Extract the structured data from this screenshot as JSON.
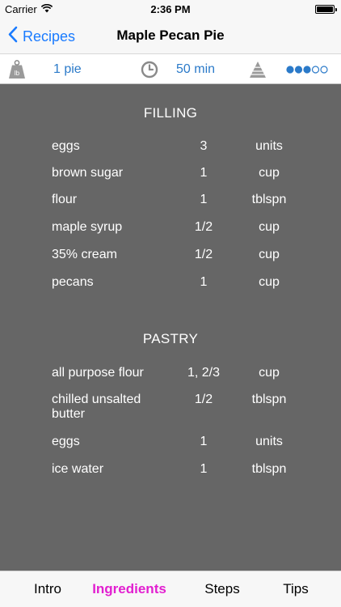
{
  "status": {
    "carrier": "Carrier",
    "time": "2:36 PM"
  },
  "nav": {
    "back_label": "Recipes",
    "title": "Maple Pecan Pie"
  },
  "info": {
    "yield": "1 pie",
    "time": "50 min",
    "difficulty_level": 3,
    "difficulty_max": 5
  },
  "sections": [
    {
      "title": "FILLING",
      "items": [
        {
          "name": "eggs",
          "qty": "3",
          "unit": "units"
        },
        {
          "name": "brown sugar",
          "qty": "1",
          "unit": "cup"
        },
        {
          "name": "flour",
          "qty": "1",
          "unit": "tblspn"
        },
        {
          "name": "maple syrup",
          "qty": "1/2",
          "unit": "cup"
        },
        {
          "name": "35% cream",
          "qty": "1/2",
          "unit": "cup"
        },
        {
          "name": "pecans",
          "qty": "1",
          "unit": "cup"
        }
      ]
    },
    {
      "title": "PASTRY",
      "items": [
        {
          "name": "all purpose flour",
          "qty": "1, 2/3",
          "unit": "cup"
        },
        {
          "name": "chilled unsalted butter",
          "qty": "1/2",
          "unit": "tblspn"
        },
        {
          "name": "eggs",
          "qty": "1",
          "unit": "units"
        },
        {
          "name": "ice water",
          "qty": "1",
          "unit": "tblspn"
        }
      ]
    }
  ],
  "tabs": [
    {
      "label": "Intro",
      "active": false
    },
    {
      "label": "Ingredients",
      "active": true
    },
    {
      "label": "Steps",
      "active": false
    },
    {
      "label": "Tips",
      "active": false
    }
  ],
  "colors": {
    "accent": "#1a7bff",
    "info_text": "#2b7ac9",
    "active_tab": "#e21fd0",
    "content_bg": "#666666"
  }
}
